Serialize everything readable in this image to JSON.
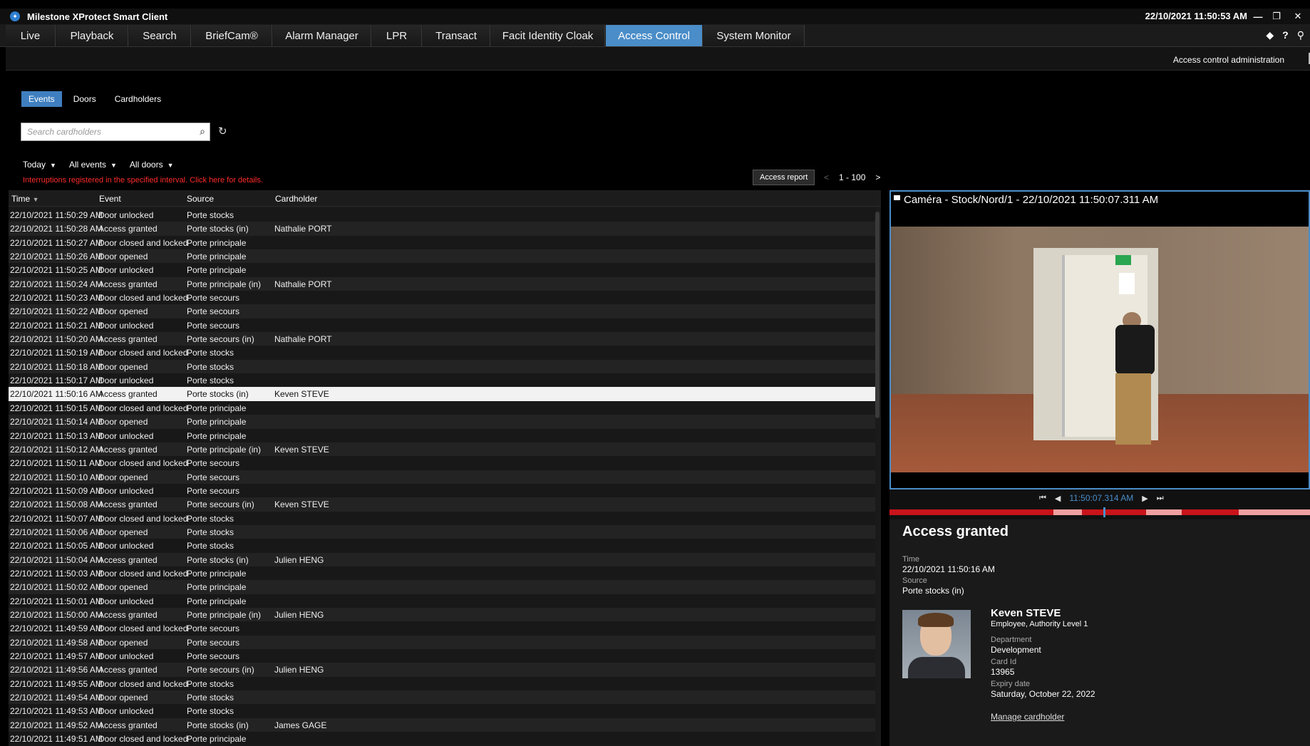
{
  "window": {
    "title": "Milestone XProtect Smart Client",
    "clock": "22/10/2021 11:50:53 AM"
  },
  "tabs": [
    {
      "label": "Live"
    },
    {
      "label": "Playback"
    },
    {
      "label": "Search"
    },
    {
      "label": "BriefCam®"
    },
    {
      "label": "Alarm Manager"
    },
    {
      "label": "LPR"
    },
    {
      "label": "Transact"
    },
    {
      "label": "Facit Identity Cloak"
    },
    {
      "label": "Access Control"
    },
    {
      "label": "System Monitor"
    }
  ],
  "active_tab": "Access Control",
  "toolbar": {
    "admin_label": "Access control administration"
  },
  "subtabs": [
    "Events",
    "Doors",
    "Cardholders"
  ],
  "search": {
    "placeholder": "Search cardholders"
  },
  "filters": {
    "period": "Today",
    "events": "All events",
    "doors": "All doors"
  },
  "warning": "Interruptions registered in the specified interval. Click here for details.",
  "access_report_label": "Access report",
  "pager": {
    "prev": "<",
    "range": "1 - 100",
    "next": ">"
  },
  "columns": {
    "time": "Time",
    "event": "Event",
    "source": "Source",
    "cardholder": "Cardholder"
  },
  "events": [
    [
      "22/10/2021 11:50:29 AM",
      "Door unlocked",
      "Porte stocks",
      ""
    ],
    [
      "22/10/2021 11:50:28 AM",
      "Access granted",
      "Porte stocks (in)",
      "Nathalie PORT"
    ],
    [
      "22/10/2021 11:50:27 AM",
      "Door closed and locked",
      "Porte principale",
      ""
    ],
    [
      "22/10/2021 11:50:26 AM",
      "Door opened",
      "Porte principale",
      ""
    ],
    [
      "22/10/2021 11:50:25 AM",
      "Door unlocked",
      "Porte principale",
      ""
    ],
    [
      "22/10/2021 11:50:24 AM",
      "Access granted",
      "Porte principale (in)",
      "Nathalie PORT"
    ],
    [
      "22/10/2021 11:50:23 AM",
      "Door closed and locked",
      "Porte secours",
      ""
    ],
    [
      "22/10/2021 11:50:22 AM",
      "Door opened",
      "Porte secours",
      ""
    ],
    [
      "22/10/2021 11:50:21 AM",
      "Door unlocked",
      "Porte secours",
      ""
    ],
    [
      "22/10/2021 11:50:20 AM",
      "Access granted",
      "Porte secours  (in)",
      "Nathalie PORT"
    ],
    [
      "22/10/2021 11:50:19 AM",
      "Door closed and locked",
      "Porte stocks",
      ""
    ],
    [
      "22/10/2021 11:50:18 AM",
      "Door opened",
      "Porte stocks",
      ""
    ],
    [
      "22/10/2021 11:50:17 AM",
      "Door unlocked",
      "Porte stocks",
      ""
    ],
    [
      "22/10/2021 11:50:16 AM",
      "Access granted",
      "Porte stocks (in)",
      "Keven STEVE"
    ],
    [
      "22/10/2021 11:50:15 AM",
      "Door closed and locked",
      "Porte principale",
      ""
    ],
    [
      "22/10/2021 11:50:14 AM",
      "Door opened",
      "Porte principale",
      ""
    ],
    [
      "22/10/2021 11:50:13 AM",
      "Door unlocked",
      "Porte principale",
      ""
    ],
    [
      "22/10/2021 11:50:12 AM",
      "Access granted",
      "Porte principale (in)",
      "Keven STEVE"
    ],
    [
      "22/10/2021 11:50:11 AM",
      "Door closed and locked",
      "Porte secours",
      ""
    ],
    [
      "22/10/2021 11:50:10 AM",
      "Door opened",
      "Porte secours",
      ""
    ],
    [
      "22/10/2021 11:50:09 AM",
      "Door unlocked",
      "Porte secours",
      ""
    ],
    [
      "22/10/2021 11:50:08 AM",
      "Access granted",
      "Porte secours  (in)",
      "Keven STEVE"
    ],
    [
      "22/10/2021 11:50:07 AM",
      "Door closed and locked",
      "Porte stocks",
      ""
    ],
    [
      "22/10/2021 11:50:06 AM",
      "Door opened",
      "Porte stocks",
      ""
    ],
    [
      "22/10/2021 11:50:05 AM",
      "Door unlocked",
      "Porte stocks",
      ""
    ],
    [
      "22/10/2021 11:50:04 AM",
      "Access granted",
      "Porte stocks (in)",
      "Julien HENG"
    ],
    [
      "22/10/2021 11:50:03 AM",
      "Door closed and locked",
      "Porte principale",
      ""
    ],
    [
      "22/10/2021 11:50:02 AM",
      "Door opened",
      "Porte principale",
      ""
    ],
    [
      "22/10/2021 11:50:01 AM",
      "Door unlocked",
      "Porte principale",
      ""
    ],
    [
      "22/10/2021 11:50:00 AM",
      "Access granted",
      "Porte principale (in)",
      "Julien HENG"
    ],
    [
      "22/10/2021 11:49:59 AM",
      "Door closed and locked",
      "Porte secours",
      ""
    ],
    [
      "22/10/2021 11:49:58 AM",
      "Door opened",
      "Porte secours",
      ""
    ],
    [
      "22/10/2021 11:49:57 AM",
      "Door unlocked",
      "Porte secours",
      ""
    ],
    [
      "22/10/2021 11:49:56 AM",
      "Access granted",
      "Porte secours  (in)",
      "Julien HENG"
    ],
    [
      "22/10/2021 11:49:55 AM",
      "Door closed and locked",
      "Porte stocks",
      ""
    ],
    [
      "22/10/2021 11:49:54 AM",
      "Door opened",
      "Porte stocks",
      ""
    ],
    [
      "22/10/2021 11:49:53 AM",
      "Door unlocked",
      "Porte stocks",
      ""
    ],
    [
      "22/10/2021 11:49:52 AM",
      "Access granted",
      "Porte stocks (in)",
      "James GAGE"
    ],
    [
      "22/10/2021 11:49:51 AM",
      "Door closed and locked",
      "Porte principale",
      ""
    ]
  ],
  "selected_row": 13,
  "camera": {
    "title": "Caméra - Stock/Nord/1 - 22/10/2021 11:50:07.311 AM",
    "playback_time": "11:50:07.314 AM"
  },
  "detail": {
    "title": "Access granted",
    "time_label": "Time",
    "time_value": "22/10/2021 11:50:16 AM",
    "source_label": "Source",
    "source_value": "Porte stocks (in)",
    "name": "Keven STEVE",
    "role": "Employee, Authority Level 1",
    "department_label": "Department",
    "department_value": "Development",
    "cardid_label": "Card Id",
    "cardid_value": "13965",
    "expiry_label": "Expiry date",
    "expiry_value": "Saturday, October 22, 2022",
    "manage_link": "Manage cardholder"
  },
  "colors": {
    "accent": "#4a8dc8",
    "warning": "#ff2b2b",
    "timeline": "#c8131a"
  }
}
